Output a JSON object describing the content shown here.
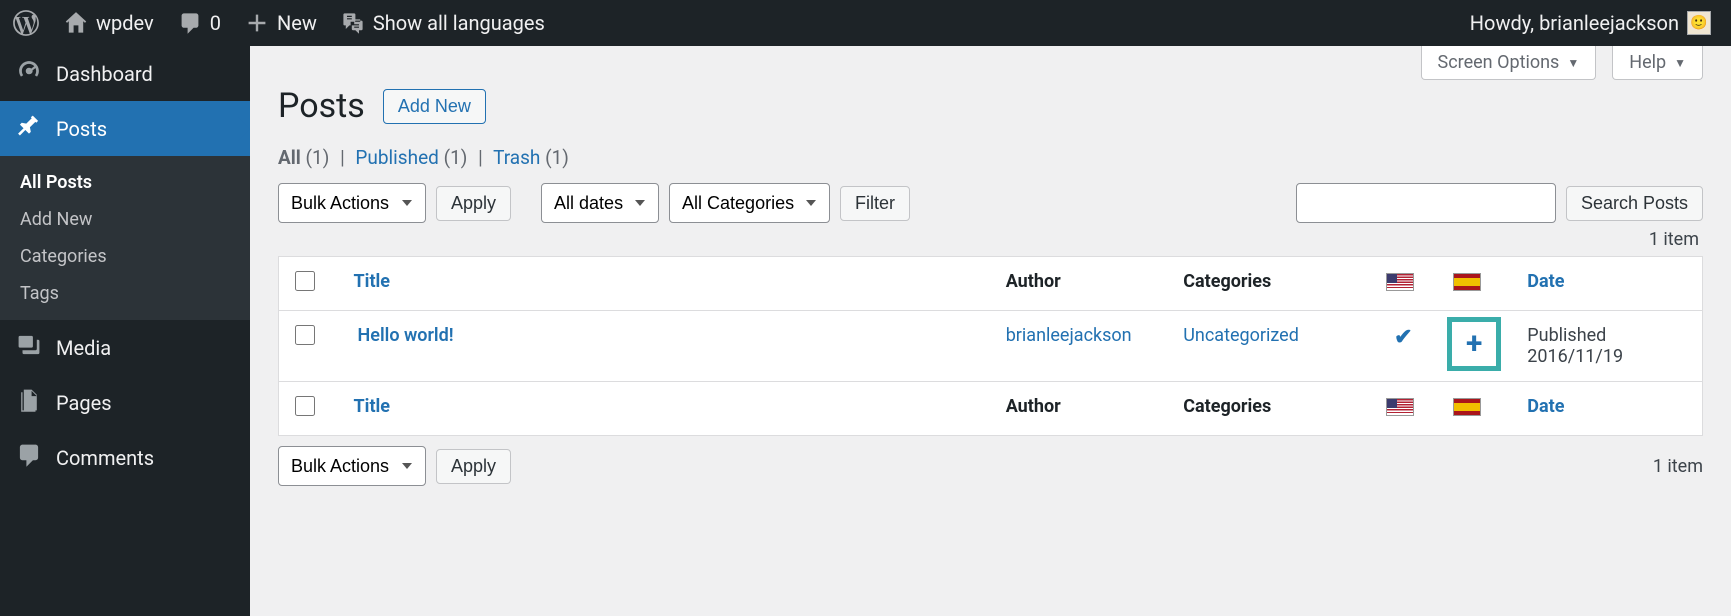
{
  "adminbar": {
    "site_name": "wpdev",
    "comments_count": "0",
    "new_label": "New",
    "languages_label": "Show all languages",
    "howdy_prefix": "Howdy, ",
    "username": "brianleejackson"
  },
  "sidemenu": {
    "dashboard": "Dashboard",
    "posts": "Posts",
    "media": "Media",
    "pages": "Pages",
    "comments": "Comments",
    "posts_submenu": {
      "all_posts": "All Posts",
      "add_new": "Add New",
      "categories": "Categories",
      "tags": "Tags"
    }
  },
  "screen_meta": {
    "options": "Screen Options",
    "help": "Help"
  },
  "heading": {
    "title": "Posts",
    "add_new": "Add New"
  },
  "subsubsub": {
    "all_label": "All",
    "all_count": "(1)",
    "published_label": "Published",
    "published_count": "(1)",
    "trash_label": "Trash",
    "trash_count": "(1)"
  },
  "filters": {
    "bulk_actions": "Bulk Actions",
    "apply": "Apply",
    "all_dates": "All dates",
    "all_categories": "All Categories",
    "filter": "Filter",
    "search_posts": "Search Posts",
    "item_count": "1 item"
  },
  "table": {
    "headers": {
      "title": "Title",
      "author": "Author",
      "categories": "Categories",
      "date": "Date"
    },
    "rows": [
      {
        "title": "Hello world!",
        "author": "brianleejackson",
        "categories": "Uncategorized",
        "lang_en": "check",
        "lang_es": "add",
        "date_status": "Published",
        "date_value": "2016/11/19"
      }
    ]
  },
  "icons": {
    "flag_en": "us",
    "flag_es": "es"
  }
}
